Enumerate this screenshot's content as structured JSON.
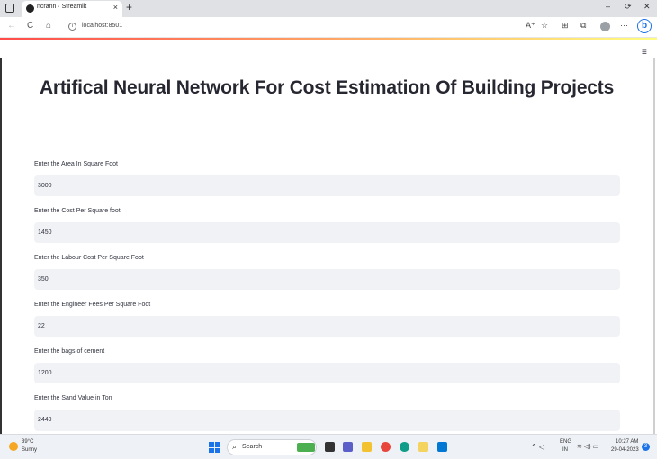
{
  "browser": {
    "tab_title": "ncrann · Streamlit",
    "tab_close": "×",
    "new_tab": "+",
    "url": "localhost:8501",
    "info_icon": "i",
    "controls": {
      "minimize": "–",
      "restore": "⟳",
      "close": "✕"
    },
    "nav": {
      "back": "←",
      "reload": "C",
      "home": "⌂"
    },
    "toolbar_icons": [
      "A⁺",
      "☆",
      "⊞",
      "☆",
      "⧉",
      "···"
    ],
    "bing_label": "b"
  },
  "app": {
    "menu_icon": "≡",
    "title": "Artifical Neural Network For Cost Estimation Of Building Projects",
    "fields": [
      {
        "label": "Enter the Area In Square Foot",
        "value": "3000"
      },
      {
        "label": "Enter the Cost Per Square foot",
        "value": "1450"
      },
      {
        "label": "Enter the Labour Cost Per Square Foot",
        "value": "350"
      },
      {
        "label": "Enter the Engineer Fees Per Square Foot",
        "value": "22"
      },
      {
        "label": "Enter the bags of cement",
        "value": "1200"
      },
      {
        "label": "Enter the Sand Value in Ton",
        "value": "2449"
      }
    ]
  },
  "taskbar": {
    "weather_temp": "39°C",
    "weather_condition": "Sunny",
    "search_icon": "⌕",
    "search_label": "Search",
    "lang_top": "ENG",
    "lang_bottom": "IN",
    "tray_icons": "⌃  ◁",
    "sys_icons": "≋ ◁) ▭",
    "time": "10:27 AM",
    "date": "29-04-2023",
    "notification_count": "3"
  },
  "colors": {
    "input_bg": "#f0f2f6",
    "accent_start": "#ff4b4b",
    "accent_end": "#fffd80",
    "text": "#31333f"
  }
}
